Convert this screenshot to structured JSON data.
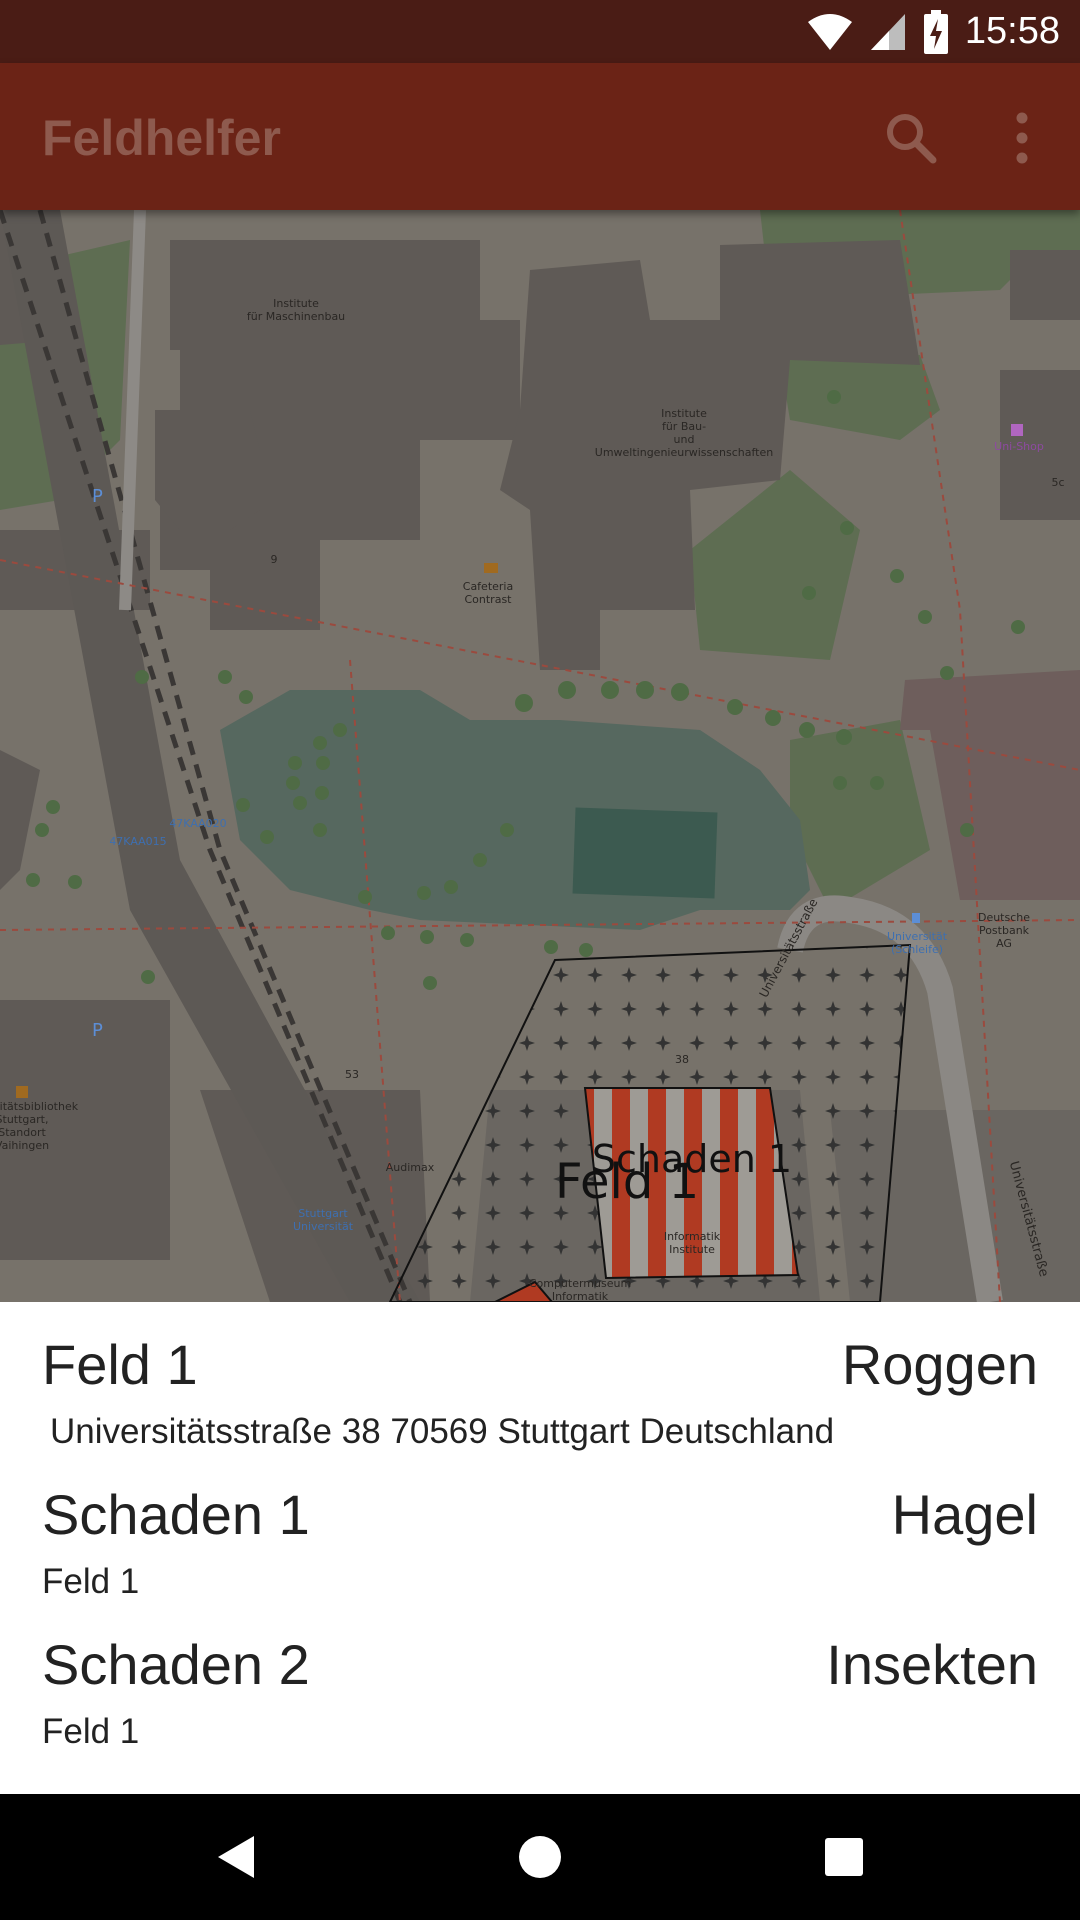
{
  "status_bar": {
    "time": "15:58"
  },
  "app_bar": {
    "title": "Feldhelfer",
    "icons": [
      "search-icon",
      "more-vert-icon"
    ]
  },
  "map": {
    "labels": {
      "maschinenbau_1": "Institute",
      "maschinenbau_2": "für Maschinenbau",
      "bau_1": "Institute",
      "bau_2": "für Bau-",
      "bau_3": "und",
      "bau_4": "Umweltingenieurwissenschaften",
      "cafeteria_1": "Cafeteria",
      "cafeteria_2": "Contrast",
      "unishop": "Uni-Shop",
      "parking_code_1": "47KAA020",
      "parking_code_2": "47KAA015",
      "street_curve": "Universitätsstraße",
      "bus_stop_1": "Universität",
      "bus_stop_2": "(Schleife)",
      "post_1": "Deutsche",
      "post_2": "Postbank",
      "post_3": "AG",
      "library_1": "sitätsbibliothek",
      "library_2": "Stuttgart,",
      "library_3": "Standort",
      "library_4": "Vaihingen",
      "audimax": "Audimax",
      "station_1": "Stuttgart",
      "station_2": "Universität",
      "informatik_1": "Informatik",
      "informatik_2": "Institute",
      "museum_1": "Computermuseum",
      "museum_2": "Informatik",
      "street_right": "Universitätsstraße",
      "house_53": "53",
      "house_38": "38",
      "house_5c": "5c",
      "house_9": "9"
    },
    "field_label": "Feld 1",
    "damage_label": "Schaden 1"
  },
  "list": [
    {
      "title": "Feld 1",
      "right": "Roggen",
      "subtitle": "Universitätsstraße 38 70569 Stuttgart Deutschland"
    },
    {
      "title": "Schaden 1",
      "right": "Hagel",
      "subtitle": "Feld 1"
    },
    {
      "title": "Schaden 2",
      "right": "Insekten",
      "subtitle": "Feld 1"
    }
  ],
  "nav_bar": {
    "icons": [
      "back-icon",
      "home-icon",
      "recents-icon"
    ]
  },
  "colors": {
    "status_bar": "#4a1c15",
    "app_bar": "#6b2316",
    "app_title": "#8e5a4e",
    "damage_stripe": "#b03a22"
  }
}
